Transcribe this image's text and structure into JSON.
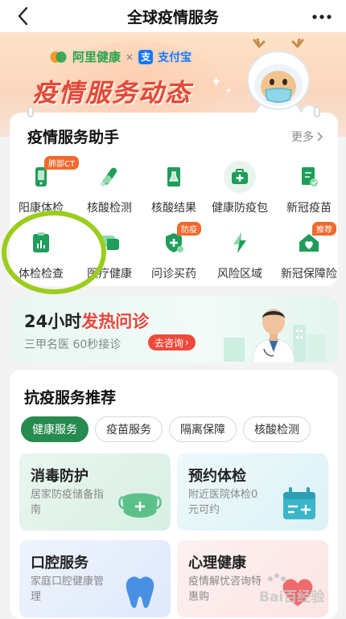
{
  "nav": {
    "title": "全球疫情服务",
    "back_icon": "chevron-left-icon",
    "more_icon": "more-dots-icon"
  },
  "banner": {
    "brand_left": "阿里健康",
    "brand_sep": "×",
    "brand_right": "支付宝",
    "brand_right_glyph": "支",
    "headline": "疫情服务动态"
  },
  "assistant": {
    "title": "疫情服务助手",
    "more": "更多",
    "row1": [
      {
        "label": "阳康体检",
        "icon": "phone-check-icon",
        "color": "#1f9d5b",
        "badge": "肺部CT"
      },
      {
        "label": "核酸检测",
        "icon": "test-tube-icon",
        "color": "#1f9d5b",
        "badge": ""
      },
      {
        "label": "核酸结果",
        "icon": "report-flask-icon",
        "color": "#1f9d5b",
        "badge": ""
      },
      {
        "label": "健康防疫包",
        "icon": "medkit-icon",
        "color": "#1f9d5b",
        "badge": ""
      },
      {
        "label": "新冠疫苗",
        "icon": "vaccine-doc-icon",
        "color": "#1f9d5b",
        "badge": ""
      }
    ],
    "row2": [
      {
        "label": "体检检查",
        "icon": "clipboard-chart-icon",
        "color": "#1f9d5b",
        "badge": ""
      },
      {
        "label": "医疗健康",
        "icon": "chat-bubble-icon",
        "color": "#1f9d5b",
        "badge": ""
      },
      {
        "label": "问诊买药",
        "icon": "shield-plus-icon",
        "color": "#1f9d5b",
        "badge": "防疫"
      },
      {
        "label": "风险区域",
        "icon": "lightning-icon",
        "color": "#1f9d5b",
        "badge": ""
      },
      {
        "label": "新冠保障险",
        "icon": "home-heart-icon",
        "color": "#1f9d5b",
        "badge": "推荐"
      }
    ]
  },
  "consult": {
    "title_prefix": "24小时",
    "title_red": "发热问诊",
    "subtitle": "三甲名医 60秒接诊",
    "button": "去咨询",
    "button_arrow": "›"
  },
  "recommend": {
    "title": "抗疫服务推荐",
    "tabs": [
      "健康服务",
      "疫苗服务",
      "隔离保障",
      "核酸检测"
    ],
    "active_tab": "健康服务",
    "tiles": [
      {
        "title": "消毒防护",
        "desc": "居家防疫储备指南",
        "icon": "mask-icon",
        "theme": "green"
      },
      {
        "title": "预约体检",
        "desc": "附近医院体检0元可约",
        "icon": "calendar-plus-icon",
        "theme": "cyan"
      },
      {
        "title": "口腔服务",
        "desc": "家庭口腔健康管理",
        "icon": "tooth-icon",
        "theme": "blue"
      },
      {
        "title": "心理健康",
        "desc": "疫情解忧咨询特惠购",
        "icon": "heart-icon",
        "theme": "pink"
      }
    ]
  },
  "watermark": {
    "text": "Bai百经验"
  },
  "colors": {
    "brand_green": "#278a4f",
    "accent_red": "#e8453c",
    "badge_orange": "#f06a2e",
    "ring": "#9acd1c"
  }
}
